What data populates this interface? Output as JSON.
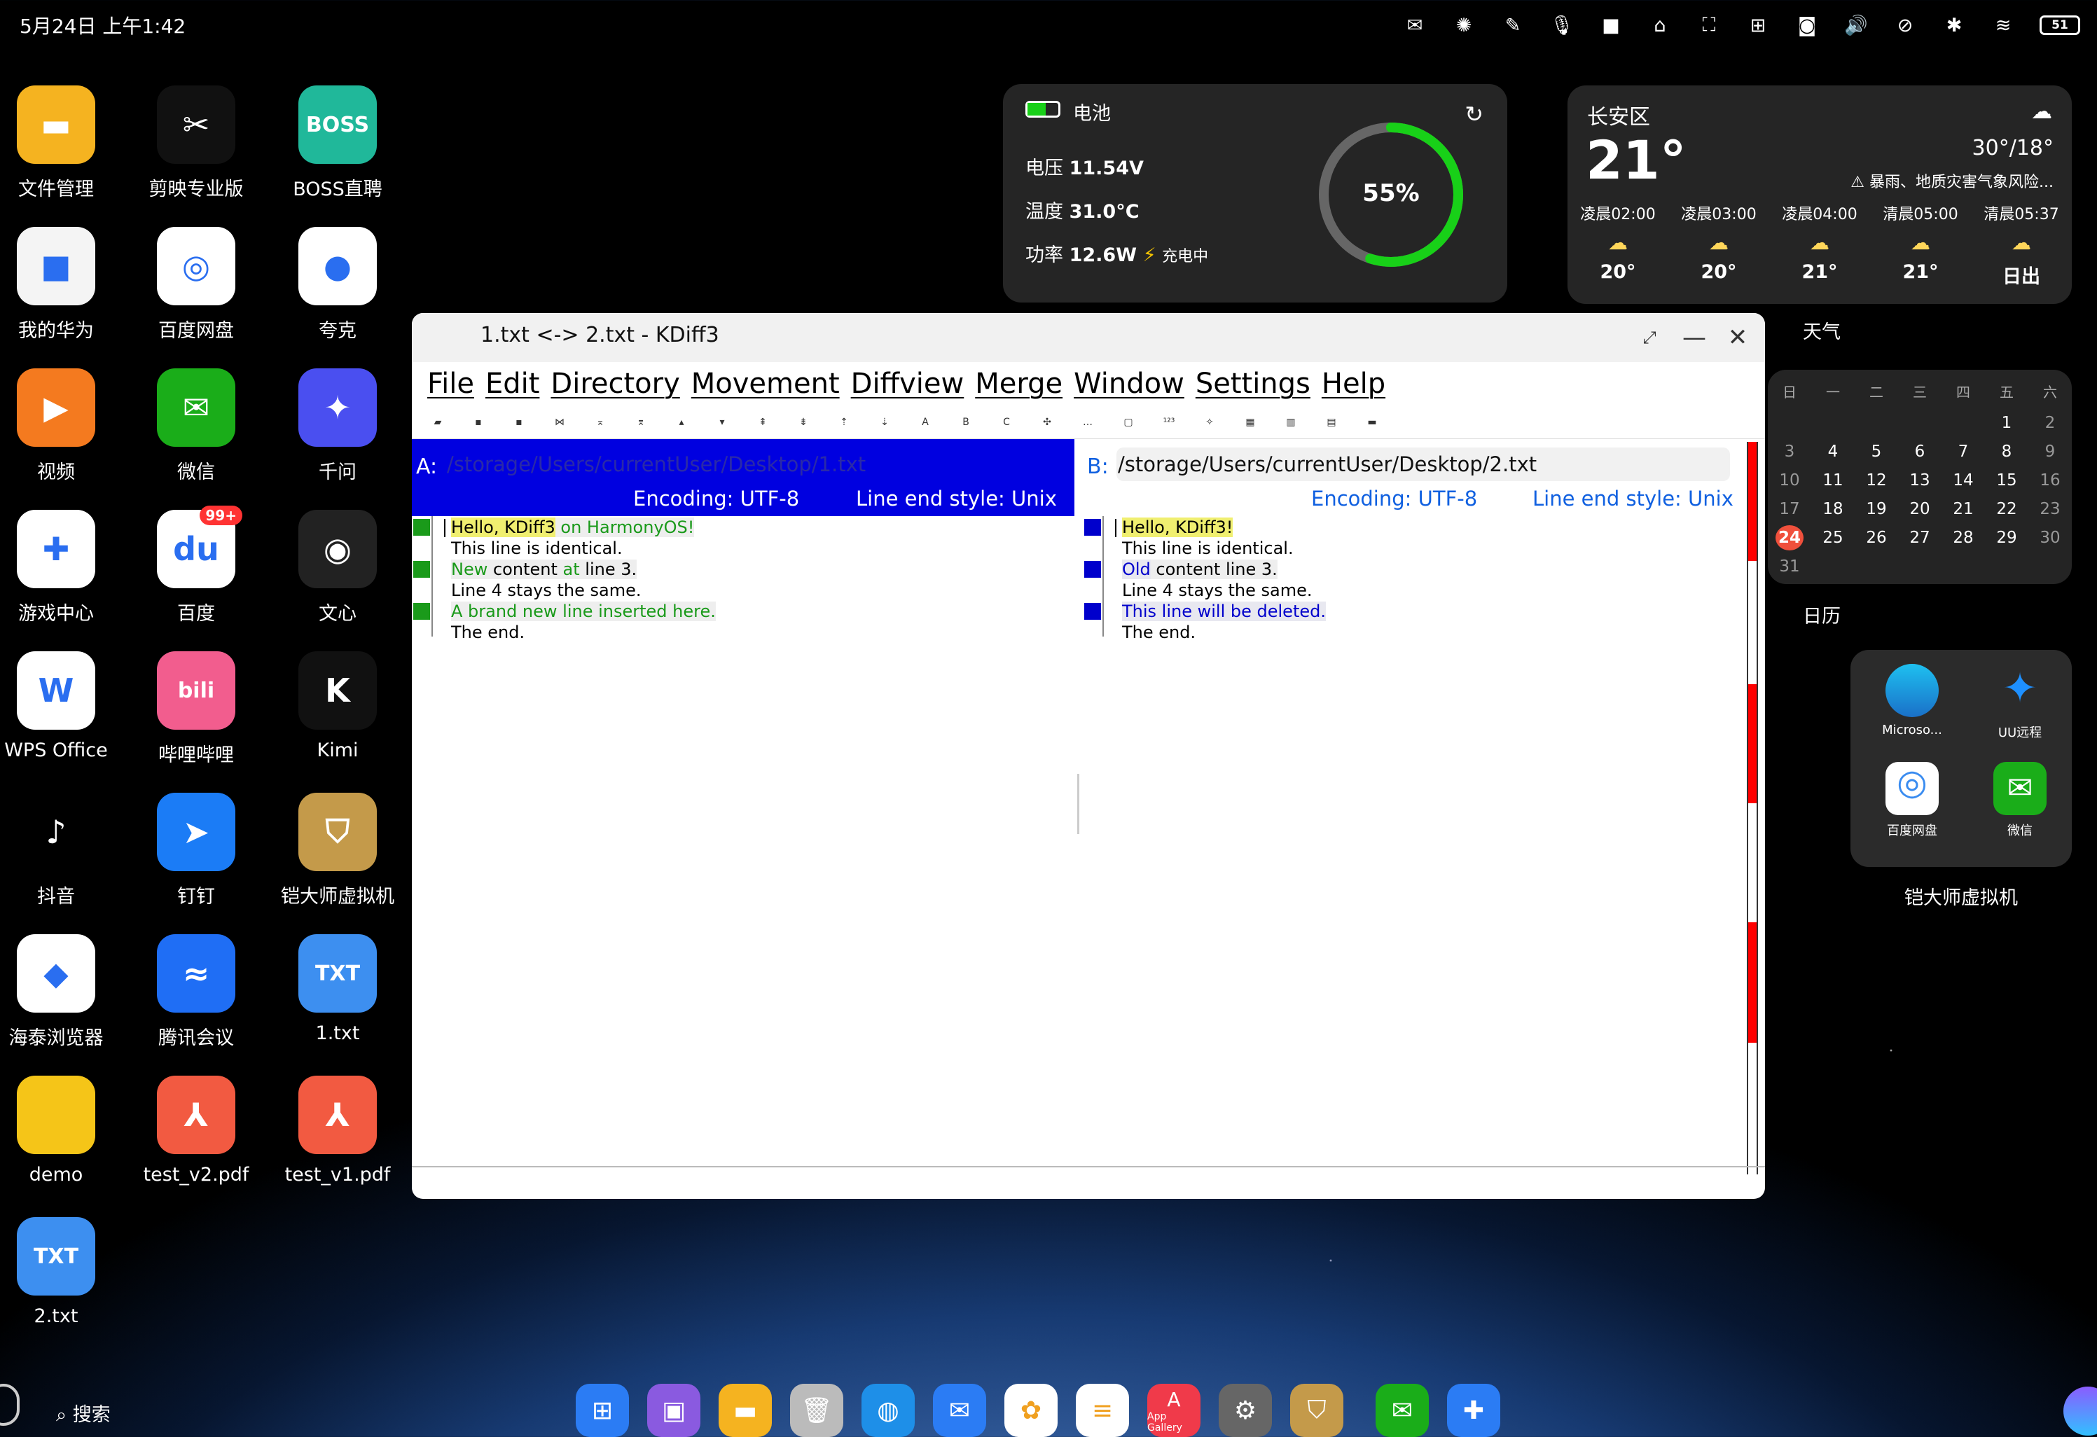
{
  "status": {
    "time": "5月24日 上午1:42",
    "battery": "51"
  },
  "desktop_apps": [
    {
      "label": "文件管理",
      "color": "#f5b320",
      "glyph": "▬"
    },
    {
      "label": "剪映专业版",
      "color": "#111",
      "glyph": "✂"
    },
    {
      "label": "BOSS直聘",
      "color": "#20b89a",
      "glyph": "BOSS"
    },
    {
      "label": "我的华为",
      "color": "#f4f4f4",
      "glyph": "■"
    },
    {
      "label": "百度网盘",
      "color": "#fff",
      "glyph": "◎"
    },
    {
      "label": "夸克",
      "color": "#fff",
      "glyph": "●"
    },
    {
      "label": "视频",
      "color": "#f47a1f",
      "glyph": "▶"
    },
    {
      "label": "微信",
      "color": "#1aad19",
      "glyph": "✉"
    },
    {
      "label": "千问",
      "color": "#4a4ff0",
      "glyph": "✦"
    },
    {
      "label": "游戏中心",
      "color": "#fff",
      "glyph": "✚"
    },
    {
      "label": "百度",
      "color": "#fff",
      "glyph": "du"
    },
    {
      "label": "文心",
      "color": "#222",
      "glyph": "◉"
    },
    {
      "label": "WPS Office",
      "color": "#fff",
      "glyph": "W"
    },
    {
      "label": "哔哩哔哩",
      "color": "#f25d8e",
      "glyph": "bili"
    },
    {
      "label": "Kimi",
      "color": "#111",
      "glyph": "K"
    },
    {
      "label": "抖音",
      "color": "#000",
      "glyph": "♪"
    },
    {
      "label": "钉钉",
      "color": "#1b7cf6",
      "glyph": "➤"
    },
    {
      "label": "铠大师虚拟机",
      "color": "#c49a4a",
      "glyph": "⛉"
    },
    {
      "label": "海泰浏览器",
      "color": "#fff",
      "glyph": "◆"
    },
    {
      "label": "腾讯会议",
      "color": "#1f6ef5",
      "glyph": "≈"
    },
    {
      "label": "1.txt",
      "color": "#3d8ff0",
      "glyph": "TXT"
    },
    {
      "label": "demo",
      "color": "#f5c518",
      "glyph": ""
    },
    {
      "label": "test_v2.pdf",
      "color": "#f25a41",
      "glyph": "⅄"
    },
    {
      "label": "test_v1.pdf",
      "color": "#f25a41",
      "glyph": "⅄"
    },
    {
      "label": "2.txt",
      "color": "#3d8ff0",
      "glyph": "TXT"
    }
  ],
  "baidu_badge": "99+",
  "battery_widget": {
    "title": "电池",
    "voltage_label": "电压",
    "voltage": "11.54V",
    "temp_label": "温度",
    "temp": "31.0°C",
    "power_label": "功率",
    "power": "12.6W",
    "charging": "充电中",
    "percent": "55%",
    "level": 0.55
  },
  "weather": {
    "location": "长安区",
    "temp": "21°",
    "range": "30°/18°",
    "alert": "暴雨、地质灾害气象风险...",
    "hours": [
      {
        "t": "凌晨02:00",
        "v": "20°"
      },
      {
        "t": "凌晨03:00",
        "v": "20°"
      },
      {
        "t": "凌晨04:00",
        "v": "21°"
      },
      {
        "t": "清晨05:00",
        "v": "21°"
      },
      {
        "t": "清晨05:37",
        "v": "日出"
      }
    ],
    "caption": "天气"
  },
  "calendar": {
    "weekdays": [
      "日",
      "一",
      "二",
      "三",
      "四",
      "五",
      "六"
    ],
    "rows": [
      [
        "",
        "",
        "",
        "",
        "",
        "1",
        "2"
      ],
      [
        "3",
        "4",
        "5",
        "6",
        "7",
        "8",
        "9"
      ],
      [
        "10",
        "11",
        "12",
        "13",
        "14",
        "15",
        "16"
      ],
      [
        "17",
        "18",
        "19",
        "20",
        "21",
        "22",
        "23"
      ],
      [
        "24",
        "25",
        "26",
        "27",
        "28",
        "29",
        "30"
      ],
      [
        "31",
        "",
        "",
        "",
        "",
        "",
        ""
      ]
    ],
    "today": "24",
    "caption": "日历"
  },
  "folder": {
    "apps": [
      "Microso...",
      "UU远程",
      "百度网盘",
      "微信"
    ],
    "caption": "铠大师虚拟机"
  },
  "kdiff": {
    "title": "1.txt <-> 2.txt - KDiff3",
    "menu": [
      "File",
      "Edit",
      "Directory",
      "Movement",
      "Diffview",
      "Merge",
      "Window",
      "Settings",
      "Help"
    ],
    "a": {
      "label": "A:",
      "path": "/storage/Users/currentUser/Desktop/1.txt",
      "encoding": "Encoding: UTF-8",
      "line_end": "Line end style: Unix"
    },
    "b": {
      "label": "B:",
      "path": "/storage/Users/currentUser/Desktop/2.txt",
      "encoding": "Encoding: UTF-8",
      "line_end": "Line end style: Unix"
    },
    "lines_a": [
      {
        "parts": [
          [
            "Hello, KDiff3",
            "y"
          ],
          [
            " on HarmonyOS!",
            "g"
          ]
        ],
        "mark": "g"
      },
      {
        "parts": [
          [
            "This line is identical.",
            "n"
          ]
        ],
        "mark": ""
      },
      {
        "parts": [
          [
            "New",
            "g"
          ],
          [
            " content ",
            "n"
          ],
          [
            "at",
            "g"
          ],
          [
            " line 3.",
            "n"
          ]
        ],
        "mark": "g"
      },
      {
        "parts": [
          [
            "Line 4 stays the same.",
            "n"
          ]
        ],
        "mark": ""
      },
      {
        "parts": [
          [
            "A brand new line inserted here.",
            "g"
          ]
        ],
        "mark": "g"
      },
      {
        "parts": [
          [
            "The end.",
            "n"
          ]
        ],
        "mark": ""
      }
    ],
    "lines_b": [
      {
        "parts": [
          [
            "Hello, KDiff3!",
            "y"
          ]
        ],
        "mark": "b"
      },
      {
        "parts": [
          [
            "This line is identical.",
            "n"
          ]
        ],
        "mark": ""
      },
      {
        "parts": [
          [
            "Old",
            "b"
          ],
          [
            " content line 3.",
            "n"
          ]
        ],
        "mark": "b"
      },
      {
        "parts": [
          [
            "Line 4 stays the same.",
            "n"
          ]
        ],
        "mark": ""
      },
      {
        "parts": [
          [
            "This line will be deleted.",
            "b"
          ]
        ],
        "mark": "b"
      },
      {
        "parts": [
          [
            "The end.",
            "n"
          ]
        ],
        "mark": ""
      }
    ]
  },
  "search_label": "搜索",
  "dock": [
    "apps",
    "files",
    "folder",
    "trash",
    "browser",
    "mail",
    "gallery",
    "notes",
    "App Gallery",
    "settings",
    "vm",
    "wechat",
    "puzzle"
  ],
  "colors": {
    "accent_blue": "#0000e0",
    "diff_green": "#1a9a1a",
    "diff_blue": "#0000cc",
    "battery_green": "#18d018"
  }
}
